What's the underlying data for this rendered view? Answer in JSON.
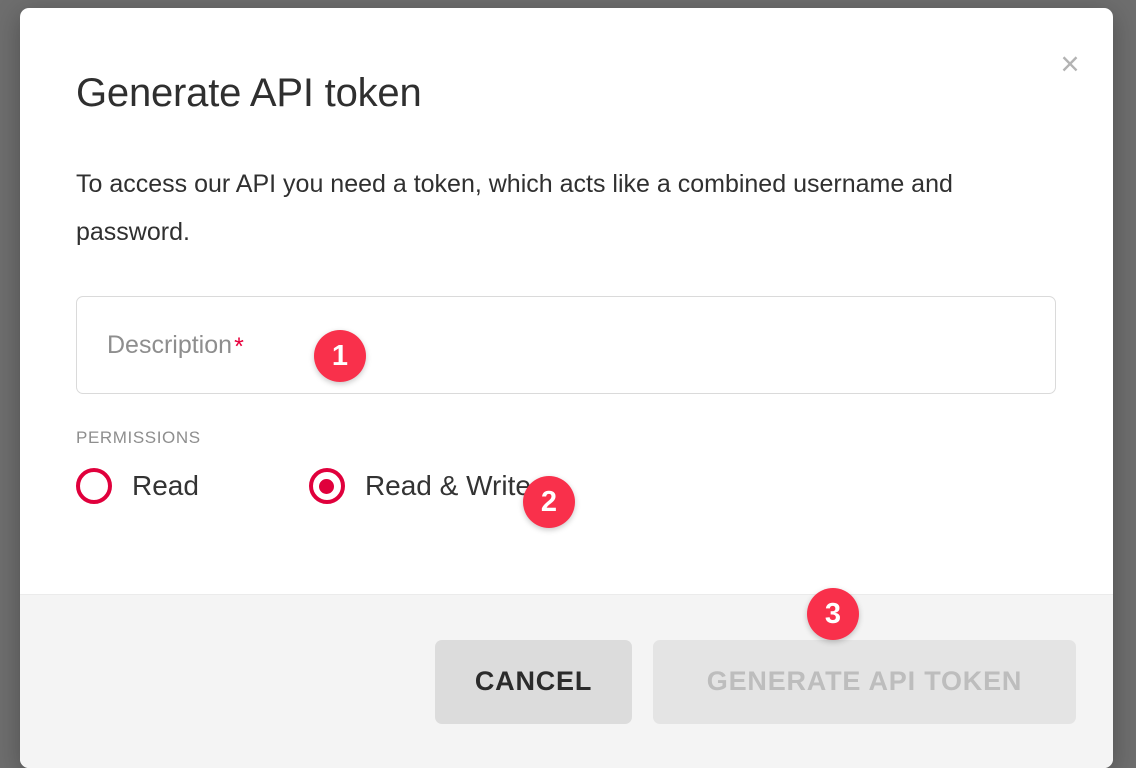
{
  "dialog": {
    "title": "Generate API token",
    "intro": "To access our API you need a token, which acts like a combined username and password.",
    "close_label": "×"
  },
  "form": {
    "description": {
      "label": "Description",
      "placeholder": "Description",
      "value": "",
      "required_marker": "*"
    },
    "permissions": {
      "label": "PERMISSIONS",
      "options": [
        {
          "label": "Read",
          "selected": false
        },
        {
          "label": "Read & Write",
          "selected": true
        }
      ]
    }
  },
  "footer": {
    "cancel_label": "CANCEL",
    "submit_label": "GENERATE API TOKEN",
    "submit_disabled": true
  },
  "badges": [
    {
      "number": "1"
    },
    {
      "number": "2"
    },
    {
      "number": "3"
    }
  ],
  "colors": {
    "badge": "#f9304b",
    "accent_red": "#e0003c",
    "required_star": "#e8003c",
    "overlay": "#6e6e6e",
    "footer_bg": "#f4f4f4",
    "cancel_bg": "#dcdcdc",
    "submit_disabled_bg": "#e4e4e4",
    "submit_disabled_text": "#bdbdbd"
  }
}
